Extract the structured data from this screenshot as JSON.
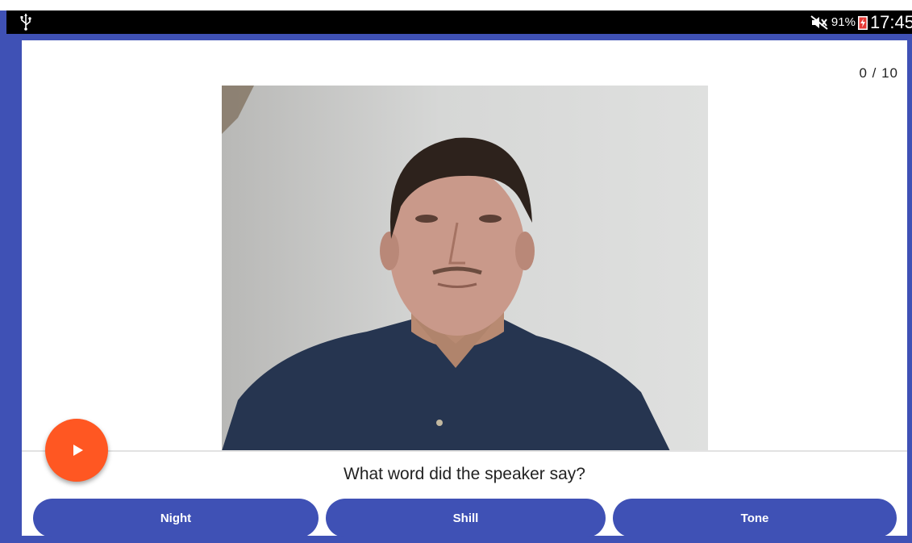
{
  "status_bar": {
    "battery": "91%",
    "time": "17:45",
    "icons": [
      "usb-icon",
      "mute-icon",
      "battery-icon"
    ]
  },
  "quiz": {
    "progress": "0 / 10",
    "question": "What word did the speaker say?",
    "answers": [
      "Night",
      "Shill",
      "Tone"
    ]
  },
  "controls": {
    "play_icon": "play-icon"
  },
  "colors": {
    "primary": "#3f51b5",
    "accent": "#ff5722",
    "status_bar": "#000000"
  }
}
